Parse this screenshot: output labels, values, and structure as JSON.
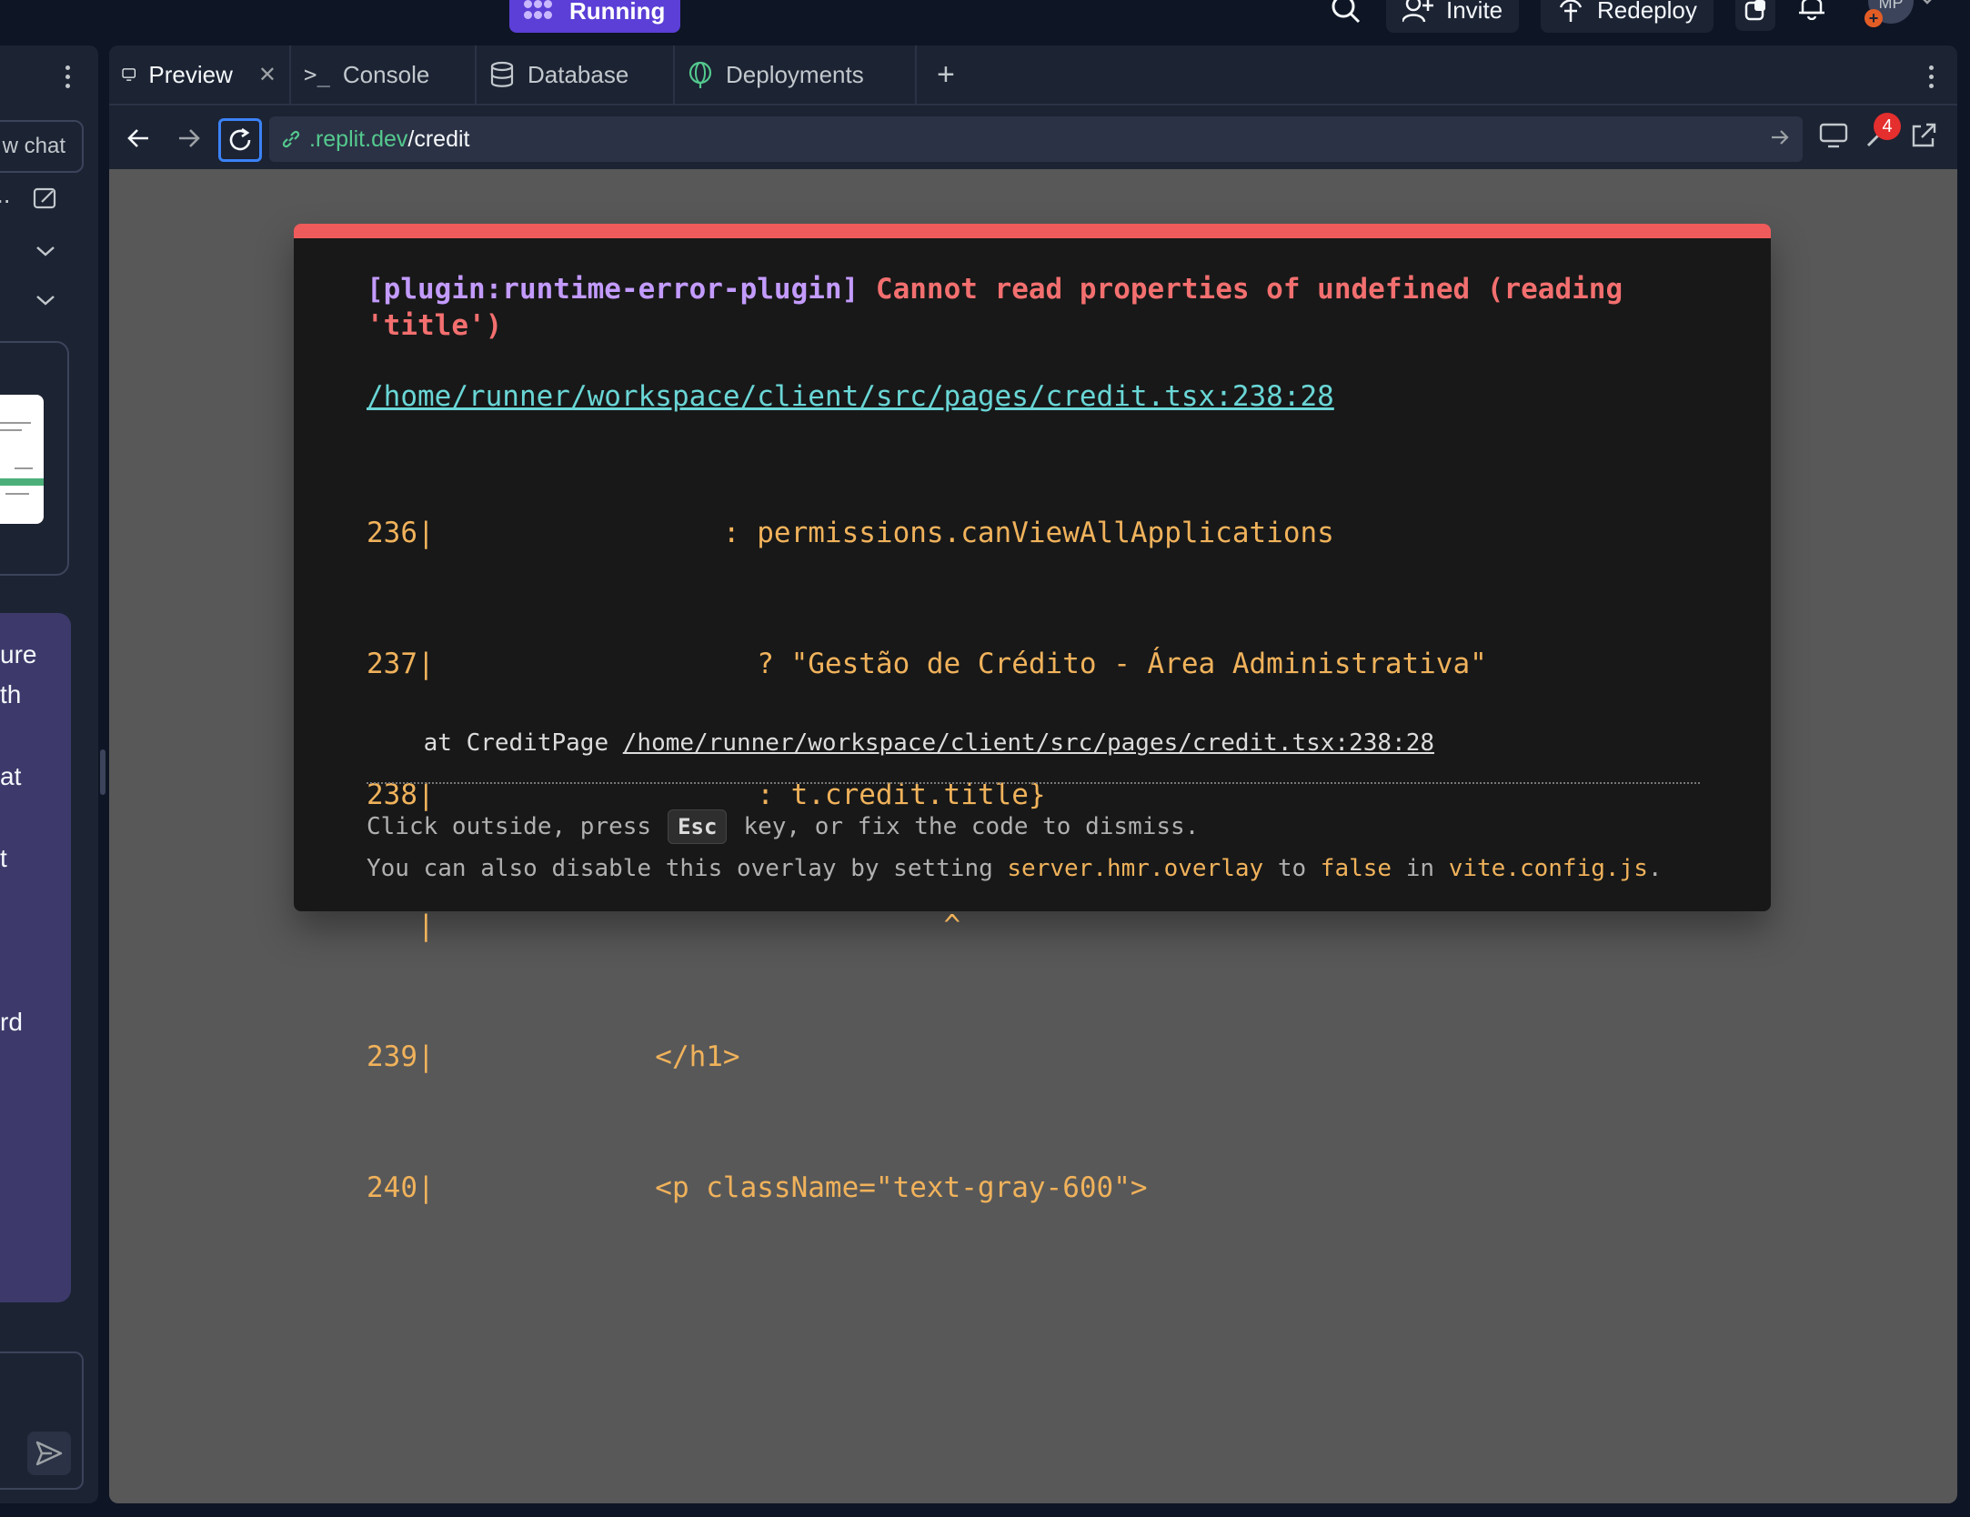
{
  "topbar": {
    "run_label": "Running",
    "invite_label": "Invite",
    "redeploy_label": "Redeploy",
    "avatar_initials": "MP"
  },
  "sidebar": {
    "new_chat_label": "w chat",
    "ellipsis": "..",
    "chat_fragments": [
      "ure",
      "th",
      "at",
      "t",
      "rd"
    ]
  },
  "tabs": [
    {
      "label": "Preview",
      "icon": "monitor-icon",
      "active": true
    },
    {
      "label": "Console",
      "icon": "terminal-icon",
      "active": false
    },
    {
      "label": "Database",
      "icon": "database-icon",
      "active": false
    },
    {
      "label": "Deployments",
      "icon": "globe-icon",
      "active": false
    }
  ],
  "browser": {
    "url_host": ".replit.dev",
    "url_path": "/credit",
    "devtools_badge": "4"
  },
  "error": {
    "plugin": "[plugin:runtime-error-plugin]",
    "message": "Cannot read properties of undefined (reading 'title')",
    "file": "/home/runner/workspace/client/src/pages/credit.tsx:238:28",
    "code_frame": [
      "236|                 : permissions.canViewAllApplications",
      "237|                   ? \"Gestão de Crédito - Área Administrativa\"",
      "238|                   : t.credit.title}",
      "   |                              ^",
      "239|             </h1>",
      "240|             <p className=\"text-gray-600\">"
    ],
    "stack_prefix": "    at CreditPage ",
    "stack_file": "/home/runner/workspace/client/src/pages/credit.tsx:238:28",
    "tip_before_key": "Click outside, press",
    "tip_key": "Esc",
    "tip_after_key": "key, or fix the code to dismiss.",
    "tip2_a": "You can also disable this overlay by setting ",
    "tip2_option": "server.hmr.overlay",
    "tip2_b": " to ",
    "tip2_false": "false",
    "tip2_c": " in ",
    "tip2_config": "vite.config.js",
    "tip2_d": "."
  },
  "colors": {
    "run_button": "#5b3fd6",
    "error_bar": "#ef5b5b",
    "error_text": "#f36f6f",
    "plugin_text": "#c39bff",
    "file_link": "#6ad6d6",
    "code_text": "#f0b25b",
    "url_host": "#54c98e",
    "focus_ring": "#3b82f6"
  }
}
